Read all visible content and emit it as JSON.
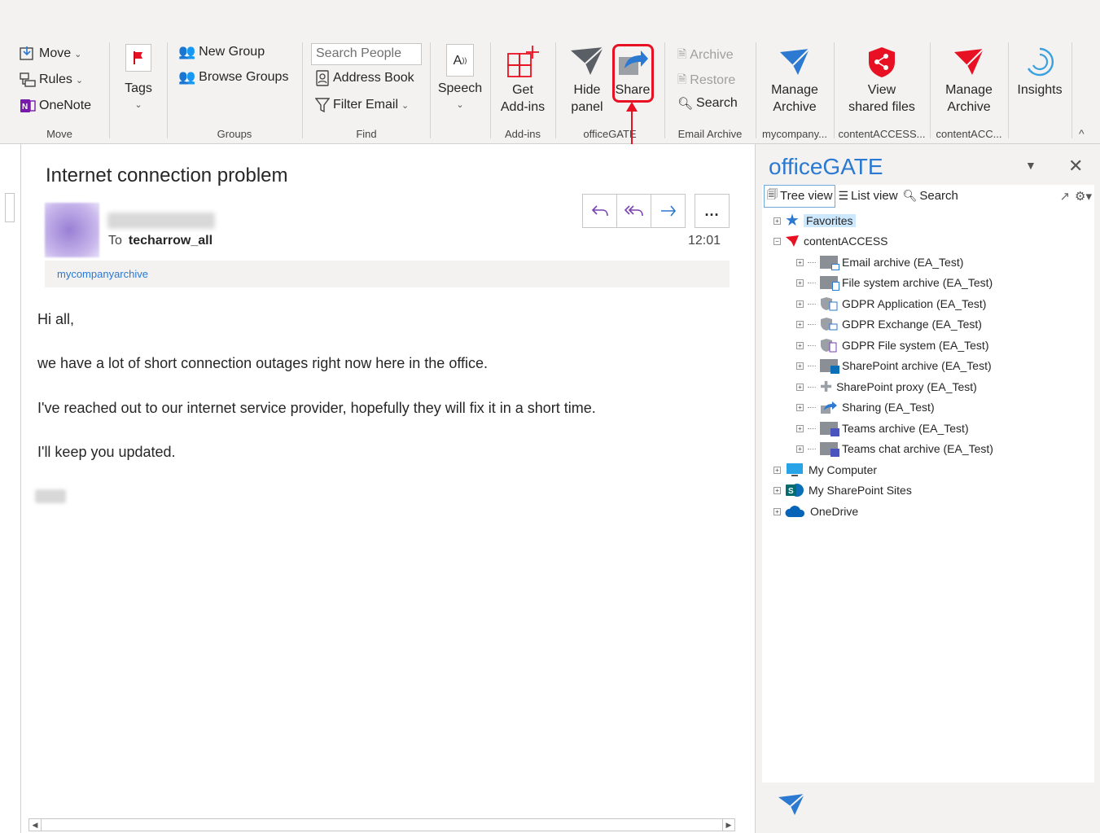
{
  "ribbon": {
    "move_group": {
      "move": "Move",
      "rules": "Rules",
      "onenote": "OneNote",
      "label": "Move"
    },
    "tags": {
      "label": "Tags"
    },
    "groups": {
      "new_group": "New Group",
      "browse_groups": "Browse Groups",
      "label": "Groups"
    },
    "find": {
      "search_placeholder": "Search People",
      "address_book": "Address Book",
      "filter_email": "Filter Email",
      "label": "Find"
    },
    "speech": {
      "label": "Speech"
    },
    "addins": {
      "get_line1": "Get",
      "get_line2": "Add-ins",
      "label": "Add-ins"
    },
    "officegate": {
      "hide_line1": "Hide",
      "hide_line2": "panel",
      "share": "Share",
      "label": "officeGATE"
    },
    "email_archive": {
      "archive": "Archive",
      "restore": "Restore",
      "search": "Search",
      "label": "Email Archive"
    },
    "mycompany": {
      "line1": "Manage",
      "line2": "Archive",
      "label": "mycompany..."
    },
    "contentaccess1": {
      "line1": "View",
      "line2": "shared files",
      "label": "contentACCESS..."
    },
    "contentaccess2": {
      "line1": "Manage",
      "line2": "Archive",
      "label": "contentACC..."
    },
    "insights": {
      "label": "Insights"
    },
    "collapse": "^"
  },
  "email": {
    "subject": "Internet connection problem",
    "to_label": "To",
    "to_value": "techarrow_all",
    "time": "12:01",
    "folder": "mycompanyarchive",
    "more": "...",
    "body": [
      "Hi all,",
      "we have a lot of short connection outages right now here in the office.",
      "I've reached out to our internet service provider, hopefully they will fix it in a short time.",
      "I'll keep you updated."
    ]
  },
  "panel": {
    "title": "officeGATE",
    "toolbar": {
      "tree_view": "Tree view",
      "list_view": "List view",
      "search": "Search"
    },
    "tree": {
      "favorites": "Favorites",
      "contentaccess": "contentACCESS",
      "children": [
        "Email archive (EA_Test)",
        "File system archive (EA_Test)",
        "GDPR Application (EA_Test)",
        "GDPR Exchange (EA_Test)",
        "GDPR File system (EA_Test)",
        "SharePoint archive (EA_Test)",
        "SharePoint proxy (EA_Test)",
        "Sharing (EA_Test)",
        "Teams archive (EA_Test)",
        "Teams chat archive (EA_Test)"
      ],
      "my_computer": "My Computer",
      "my_sharepoint": "My SharePoint Sites",
      "onedrive": "OneDrive"
    }
  },
  "colors": {
    "accent": "#2b79d0",
    "highlight": "#e81123",
    "officegate_red": "#e81123"
  }
}
